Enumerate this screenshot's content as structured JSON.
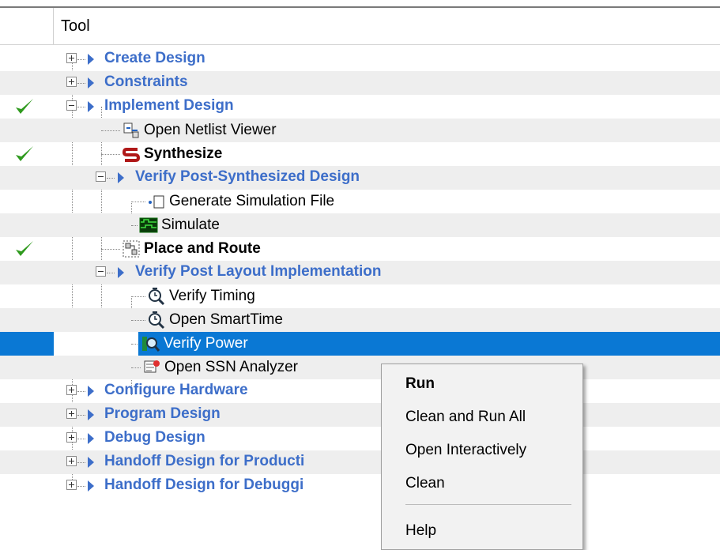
{
  "header": {
    "column_title": "Tool"
  },
  "tree": {
    "create_design": "Create Design",
    "constraints": "Constraints",
    "implement_design": "Implement Design",
    "open_netlist_viewer": "Open Netlist Viewer",
    "synthesize": "Synthesize",
    "verify_post_synth": "Verify Post-Synthesized Design",
    "generate_sim_file": "Generate Simulation File",
    "simulate": "Simulate",
    "place_and_route": "Place and Route",
    "verify_post_layout": "Verify Post Layout Implementation",
    "verify_timing": "Verify Timing",
    "open_smarttime": "Open SmartTime",
    "verify_power": "Verify Power",
    "open_ssn_analyzer": "Open SSN Analyzer",
    "configure_hardware": "Configure Hardware",
    "program_design": "Program Design",
    "debug_design": "Debug Design",
    "handoff_production": "Handoff Design for Producti",
    "handoff_debugging": "Handoff Design for Debuggi"
  },
  "context_menu": {
    "run": "Run",
    "clean_and_run_all": "Clean and Run All",
    "open_interactively": "Open Interactively",
    "clean": "Clean",
    "help": "Help"
  },
  "colors": {
    "group_text": "#3d6ec9",
    "selection": "#0a78d4",
    "check": "#2f9a1e"
  }
}
